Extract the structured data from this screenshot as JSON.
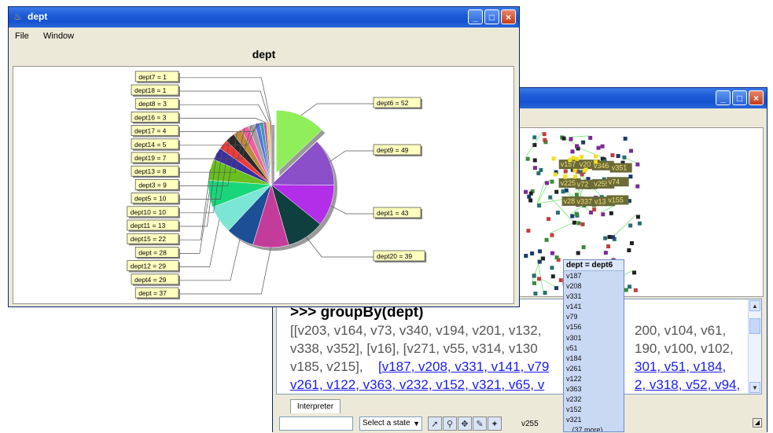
{
  "window_main": {
    "title": "dept",
    "menu": [
      "File",
      "Window"
    ],
    "chart_title": "dept"
  },
  "chart_data": {
    "type": "pie",
    "title": "dept",
    "slices": [
      {
        "label": "dept6 = 52",
        "value": 52,
        "color": "#90ee5a"
      },
      {
        "label": "dept9 = 49",
        "value": 49,
        "color": "#8a4fc9"
      },
      {
        "label": "dept1 = 43",
        "value": 43,
        "color": "#b22ee8"
      },
      {
        "label": "dept20 = 39",
        "value": 39,
        "color": "#0f3f3f"
      },
      {
        "label": "dept = 37",
        "value": 37,
        "color": "#c43c9a"
      },
      {
        "label": "dept4 = 29",
        "value": 29,
        "color": "#1d4f96"
      },
      {
        "label": "dept12 = 29",
        "value": 29,
        "color": "#7ce6d6"
      },
      {
        "label": "dept = 28",
        "value": 28,
        "color": "#19d67a"
      },
      {
        "label": "dept15 = 22",
        "value": 22,
        "color": "#68c01e"
      },
      {
        "label": "dept11 = 13",
        "value": 13,
        "color": "#3a2ea0"
      },
      {
        "label": "dept10 = 10",
        "value": 10,
        "color": "#ee3a3a"
      },
      {
        "label": "dept5 = 10",
        "value": 10,
        "color": "#2a2a2a"
      },
      {
        "label": "dept3 = 9",
        "value": 9,
        "color": "#c08a3a"
      },
      {
        "label": "dept13 = 8",
        "value": 8,
        "color": "#ee5fa2"
      },
      {
        "label": "dept19 = 7",
        "value": 7,
        "color": "#a0a0a0"
      },
      {
        "label": "dept14 = 5",
        "value": 5,
        "color": "#5a6fe8"
      },
      {
        "label": "dept17 = 4",
        "value": 4,
        "color": "#3aa0a0"
      },
      {
        "label": "dept16 = 3",
        "value": 3,
        "color": "#cc44cc"
      },
      {
        "label": "dept8 = 3",
        "value": 3,
        "color": "#d4d43a"
      },
      {
        "label": "dept18 = 1",
        "value": 1,
        "color": "#e83aa0"
      },
      {
        "label": "dept7 = 1",
        "value": 1,
        "color": "#7a3a3a"
      }
    ],
    "exploded": "dept6 = 52"
  },
  "interpreter": {
    "prompt": ">>> groupBy(dept)",
    "lines": [
      "[[v203, v164, v73, v340, v194, v201, v132,",
      "v338, v352], [v16], [v271, v55, v314, v130",
      "v185, v215], "
    ],
    "right_fragments": [
      "200, v104, v61,",
      "190, v100, v102,"
    ],
    "link_line_1": "[v187, v208, v331, v141, v79",
    "link_line_1_tail": "301, v51, v184,",
    "link_line_2": "v261, v122, v363, v232, v152, v321, v65, v",
    "link_line_2_tail": "2, v318, v52, v94,",
    "tab_label": "Interpreter"
  },
  "status": {
    "state_select": "Select a state",
    "current_node": "v255"
  },
  "popup": {
    "header": "dept = dept6",
    "items": [
      "v187",
      "v208",
      "v331",
      "v141",
      "v79",
      "v156",
      "v301",
      "v51",
      "v184",
      "v261",
      "v122",
      "v363",
      "v232",
      "v152",
      "v321"
    ],
    "more": "...(37 more)"
  },
  "graph_labels": [
    "v157",
    "v207",
    "v346",
    "v351",
    "v225",
    "v72",
    "v255",
    "v74",
    "v287",
    "v337",
    "v131",
    "v155"
  ]
}
